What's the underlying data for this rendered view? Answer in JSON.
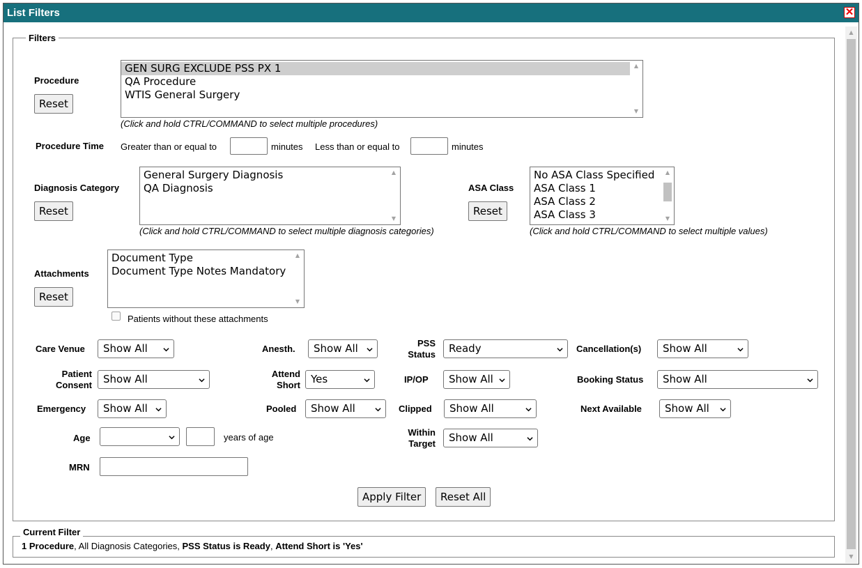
{
  "window": {
    "title": "List Filters",
    "close_icon": "close-icon",
    "close_color": "#e00000",
    "titlebar_color": "#17707d"
  },
  "filters": {
    "legend": "Filters",
    "procedure": {
      "label": "Procedure",
      "reset": "Reset",
      "options": [
        "GEN SURG EXCLUDE PSS PX 1",
        "QA Procedure",
        "WTIS General Surgery"
      ],
      "selected": "GEN SURG EXCLUDE PSS PX 1",
      "hint": "(Click and hold CTRL/COMMAND to select multiple procedures)"
    },
    "procedure_time": {
      "label": "Procedure Time",
      "gte_label": "Greater than or equal to",
      "gte_value": "",
      "unit1": "minutes",
      "lte_label": "Less than or equal to",
      "lte_value": "",
      "unit2": "minutes"
    },
    "diagnosis": {
      "label": "Diagnosis Category",
      "reset": "Reset",
      "options": [
        "General Surgery Diagnosis",
        "QA Diagnosis"
      ],
      "hint": "(Click and hold CTRL/COMMAND to select multiple diagnosis categories)"
    },
    "asa": {
      "label": "ASA Class",
      "reset": "Reset",
      "options": [
        "No ASA Class Specified",
        "ASA Class 1",
        "ASA Class 2",
        "ASA Class 3"
      ],
      "hint": "(Click and hold CTRL/COMMAND to select multiple values)"
    },
    "attachments": {
      "label": "Attachments",
      "reset": "Reset",
      "options": [
        "Document Type",
        "Document Type Notes Mandatory"
      ],
      "checkbox_label": "Patients without these attachments",
      "checked": false
    },
    "care_venue": {
      "label": "Care Venue",
      "value": "Show All"
    },
    "anesth": {
      "label": "Anesth.",
      "value": "Show All"
    },
    "pss_status": {
      "label_1": "PSS",
      "label_2": "Status",
      "value": "Ready"
    },
    "cancellations": {
      "label": "Cancellation(s)",
      "value": "Show All"
    },
    "patient_consent": {
      "label_1": "Patient",
      "label_2": "Consent",
      "value": "Show All"
    },
    "attend_short": {
      "label_1": "Attend",
      "label_2": "Short",
      "value": "Yes"
    },
    "ipop": {
      "label": "IP/OP",
      "value": "Show All"
    },
    "booking_status": {
      "label": "Booking Status",
      "value": "Show All"
    },
    "emergency": {
      "label": "Emergency",
      "value": "Show All"
    },
    "pooled": {
      "label": "Pooled",
      "value": "Show All"
    },
    "clipped": {
      "label": "Clipped",
      "value": "Show All"
    },
    "next_available": {
      "label": "Next Available",
      "value": "Show All"
    },
    "age": {
      "label": "Age",
      "operator": "",
      "value": "",
      "suffix": "years of age"
    },
    "within_target": {
      "label_1": "Within",
      "label_2": "Target",
      "value": "Show All"
    },
    "mrn": {
      "label": "MRN",
      "value": ""
    },
    "apply_filter": "Apply Filter",
    "reset_all": "Reset All"
  },
  "current_filter": {
    "legend": "Current Filter",
    "parts": {
      "p1": "1 Procedure",
      "s1": ", All Diagnosis Categories, ",
      "p2": "PSS Status is Ready",
      "s2": ", ",
      "p3": "Attend Short is 'Yes'"
    }
  }
}
